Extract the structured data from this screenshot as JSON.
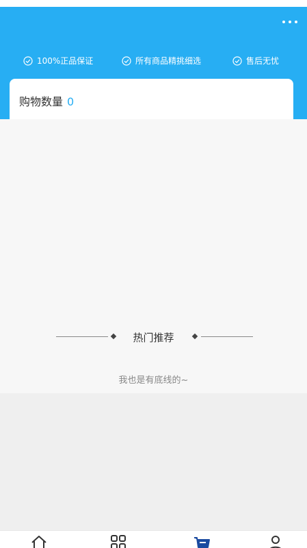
{
  "header": {
    "bg_color": "#27aef3",
    "more_icon": "more-dots-icon"
  },
  "guarantees": [
    {
      "icon": "check-circle-icon",
      "label": "100%正品保证"
    },
    {
      "icon": "check-circle-icon",
      "label": "所有商品精挑细选"
    },
    {
      "icon": "check-circle-icon",
      "label": "售后无忧"
    }
  ],
  "cart": {
    "count_label": "购物数量",
    "count_value": "0",
    "accent_color": "#27aef3"
  },
  "recommend": {
    "title": "热门推荐"
  },
  "footer_note": "我也是有底线的~",
  "tabbar": {
    "items": [
      {
        "icon": "home-icon",
        "active": false
      },
      {
        "icon": "category-grid-icon",
        "active": false
      },
      {
        "icon": "cart-icon",
        "active": true
      },
      {
        "icon": "user-icon",
        "active": false
      }
    ],
    "active_color": "#1a4aa0"
  }
}
